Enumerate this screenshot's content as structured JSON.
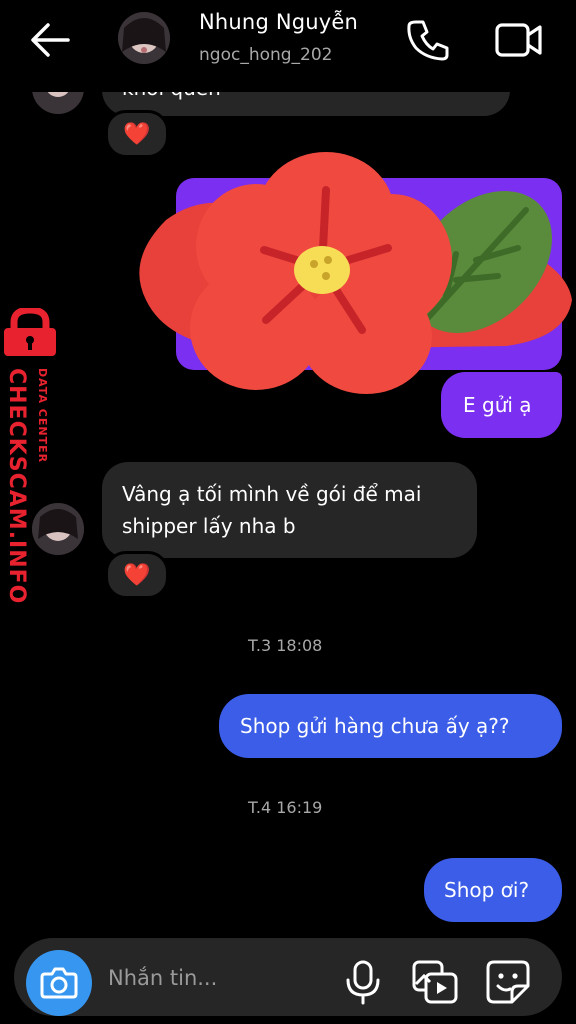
{
  "header": {
    "contact_name": "Nhung Nguyễn",
    "username": "ngoc_hong_202",
    "back_icon": "arrow-left-icon",
    "call_icon": "phone-icon",
    "video_icon": "video-camera-icon"
  },
  "messages": [
    {
      "kind": "incoming",
      "text": "khỏi quên",
      "reaction": "❤️"
    },
    {
      "kind": "outgoing-sticker",
      "sticker": "red-flower-sticker"
    },
    {
      "kind": "outgoing",
      "text": "E gửi ạ"
    },
    {
      "kind": "incoming",
      "text": "Vâng ạ tối mình về gói để mai shipper lấy nha b",
      "line1": "Vâng ạ tối mình về gói để mai",
      "line2": "shipper lấy nha b",
      "reaction": "❤️"
    },
    {
      "kind": "timestamp",
      "text": "T.3 18:08"
    },
    {
      "kind": "outgoing",
      "text": "Shop gửi hàng chưa ấy ạ??"
    },
    {
      "kind": "timestamp",
      "text": "T.4 16:19"
    },
    {
      "kind": "outgoing",
      "text": "Shop ơi?"
    }
  ],
  "composer": {
    "placeholder": "Nhắn tin...",
    "camera_icon": "camera-icon",
    "mic_icon": "microphone-icon",
    "gallery_icon": "gallery-icon",
    "sticker_icon": "sticker-icon"
  },
  "watermark": {
    "brand": "CHECKSCAM.INFO",
    "sub": "DATA CENTER"
  },
  "colors": {
    "background": "#000000",
    "incoming_bubble": "#262626",
    "outgoing_purple": "#7b2ff0",
    "outgoing_blue": "#3b5de7",
    "camera_button": "#3797f0",
    "heart": "#ed1c3a"
  }
}
